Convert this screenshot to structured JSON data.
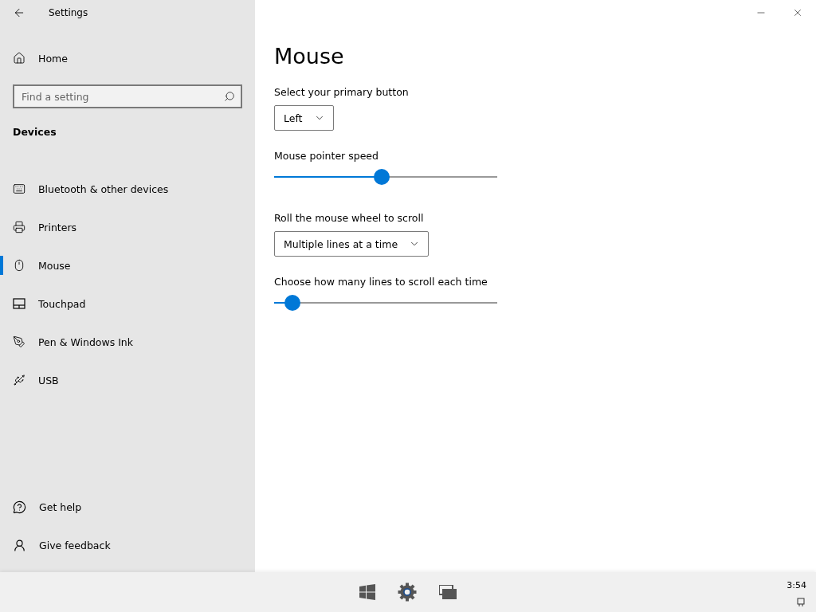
{
  "window": {
    "title": "Settings"
  },
  "sidebar": {
    "home": "Home",
    "search": {
      "placeholder": "Find a setting"
    },
    "section": "Devices",
    "items": [
      {
        "label": "Bluetooth & other devices",
        "selected": false
      },
      {
        "label": "Printers",
        "selected": false
      },
      {
        "label": "Mouse",
        "selected": true
      },
      {
        "label": "Touchpad",
        "selected": false
      },
      {
        "label": "Pen & Windows Ink",
        "selected": false
      },
      {
        "label": "USB",
        "selected": false
      }
    ],
    "footer": [
      {
        "label": "Get help"
      },
      {
        "label": "Give feedback"
      }
    ]
  },
  "page": {
    "title": "Mouse",
    "settings": [
      {
        "kind": "dropdown",
        "label": "Select your primary button",
        "value": "Left"
      },
      {
        "kind": "slider",
        "label": "Mouse pointer speed",
        "level": 0.48
      },
      {
        "kind": "dropdown",
        "label": "Roll the mouse wheel to scroll",
        "value": "Multiple lines at a time"
      },
      {
        "kind": "slider",
        "label": "Choose how many lines to scroll each time",
        "level": 0.05
      }
    ]
  },
  "taskbar": {
    "clock": "3:54"
  }
}
